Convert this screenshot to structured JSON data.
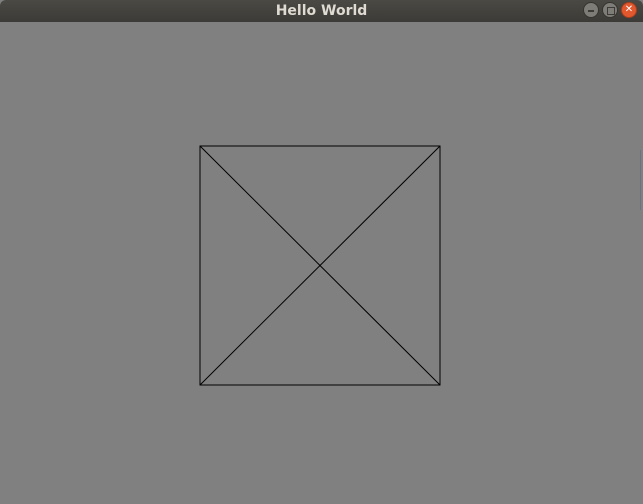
{
  "window": {
    "title": "Hello World",
    "background": "#808080",
    "controls": {
      "minimize": {
        "icon": "minimize-icon"
      },
      "maximize": {
        "icon": "maximize-icon"
      },
      "close": {
        "icon": "close-icon",
        "glyph": "✕",
        "color": "#e2582e"
      }
    }
  },
  "canvas": {
    "shapes": [
      "square",
      "diagonal-1",
      "diagonal-2"
    ],
    "stroke_color": "#000000"
  }
}
